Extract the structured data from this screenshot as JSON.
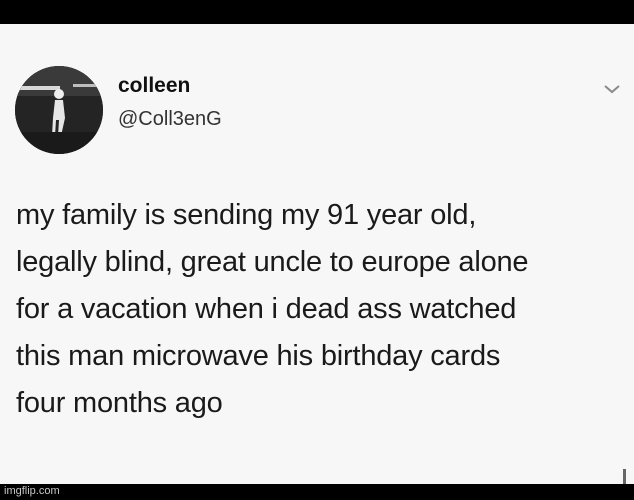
{
  "tweet": {
    "display_name": "colleen",
    "handle": "@Coll3enG",
    "text": "my family is sending my 91 year old,\nlegally blind, great uncle to europe alone\nfor a vacation when i dead ass watched\nthis man microwave his birthday cards\nfour months ago",
    "avatar_icon": "profile-photo",
    "menu_icon": "chevron-down-icon"
  },
  "footer": {
    "watermark": "imgflip.com"
  }
}
